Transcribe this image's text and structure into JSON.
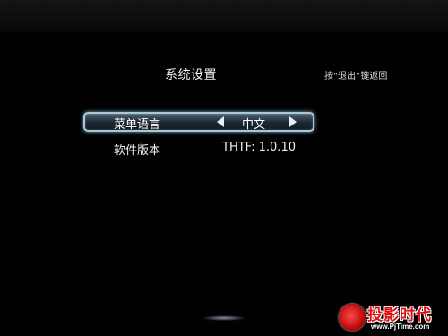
{
  "header": {
    "title": "系统设置",
    "exit_hint": "按“退出”键返回"
  },
  "menu": {
    "selected_item": {
      "label": "菜单语言",
      "value": "中文",
      "left_arrow_icon": "triangle-left-icon",
      "right_arrow_icon": "triangle-right-icon"
    },
    "info_item": {
      "label": "软件版本",
      "value": "THTF: 1.0.10"
    }
  },
  "watermark": {
    "brand": "投影时代",
    "url": "www.PjTime.com"
  },
  "colors": {
    "background": "#010101",
    "selection_border": "#a9c8d8",
    "selection_fill": "#1b2834",
    "text": "#f0f0f0",
    "watermark_red": "#e01010"
  }
}
